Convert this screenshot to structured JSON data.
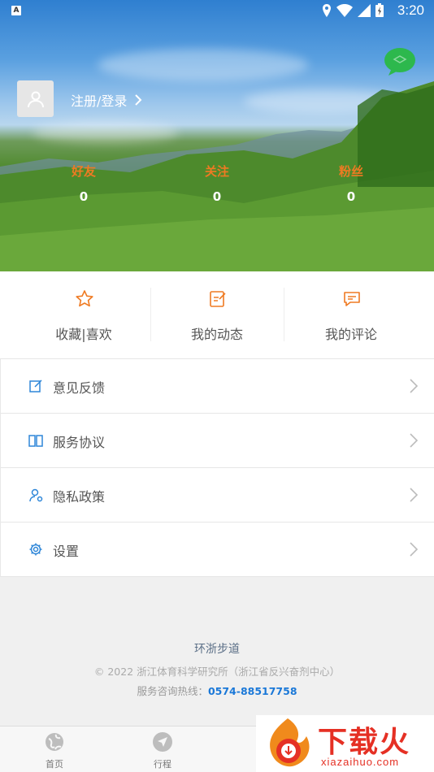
{
  "status_bar": {
    "time": "3:20"
  },
  "header": {
    "login_label": "注册/登录"
  },
  "stats": [
    {
      "label": "好友",
      "value": "0"
    },
    {
      "label": "关注",
      "value": "0"
    },
    {
      "label": "粉丝",
      "value": "0"
    }
  ],
  "quick_actions": [
    {
      "label": "收藏|喜欢",
      "icon": "star-icon"
    },
    {
      "label": "我的动态",
      "icon": "edit-note-icon"
    },
    {
      "label": "我的评论",
      "icon": "comment-icon"
    }
  ],
  "menu": [
    {
      "label": "意见反馈",
      "icon": "feedback-icon"
    },
    {
      "label": "服务协议",
      "icon": "book-icon"
    },
    {
      "label": "隐私政策",
      "icon": "privacy-user-icon"
    },
    {
      "label": "设置",
      "icon": "gear-icon"
    }
  ],
  "footer": {
    "app_name": "环浙步道",
    "copyright": "© 2022 浙江体育科学研究所（浙江省反兴奋剂中心）",
    "hotline_label": "服务咨询热线：",
    "hotline_number": "0574-88517758"
  },
  "tabbar": [
    {
      "label": "首页",
      "icon": "globe-icon"
    },
    {
      "label": "行程",
      "icon": "navigation-icon"
    }
  ],
  "watermark": {
    "text": "下载火",
    "url": "xiazaihuo.com"
  },
  "colors": {
    "accent_orange": "#ef7a22",
    "link_blue": "#1a78d8",
    "chat_green": "#2db84d"
  }
}
